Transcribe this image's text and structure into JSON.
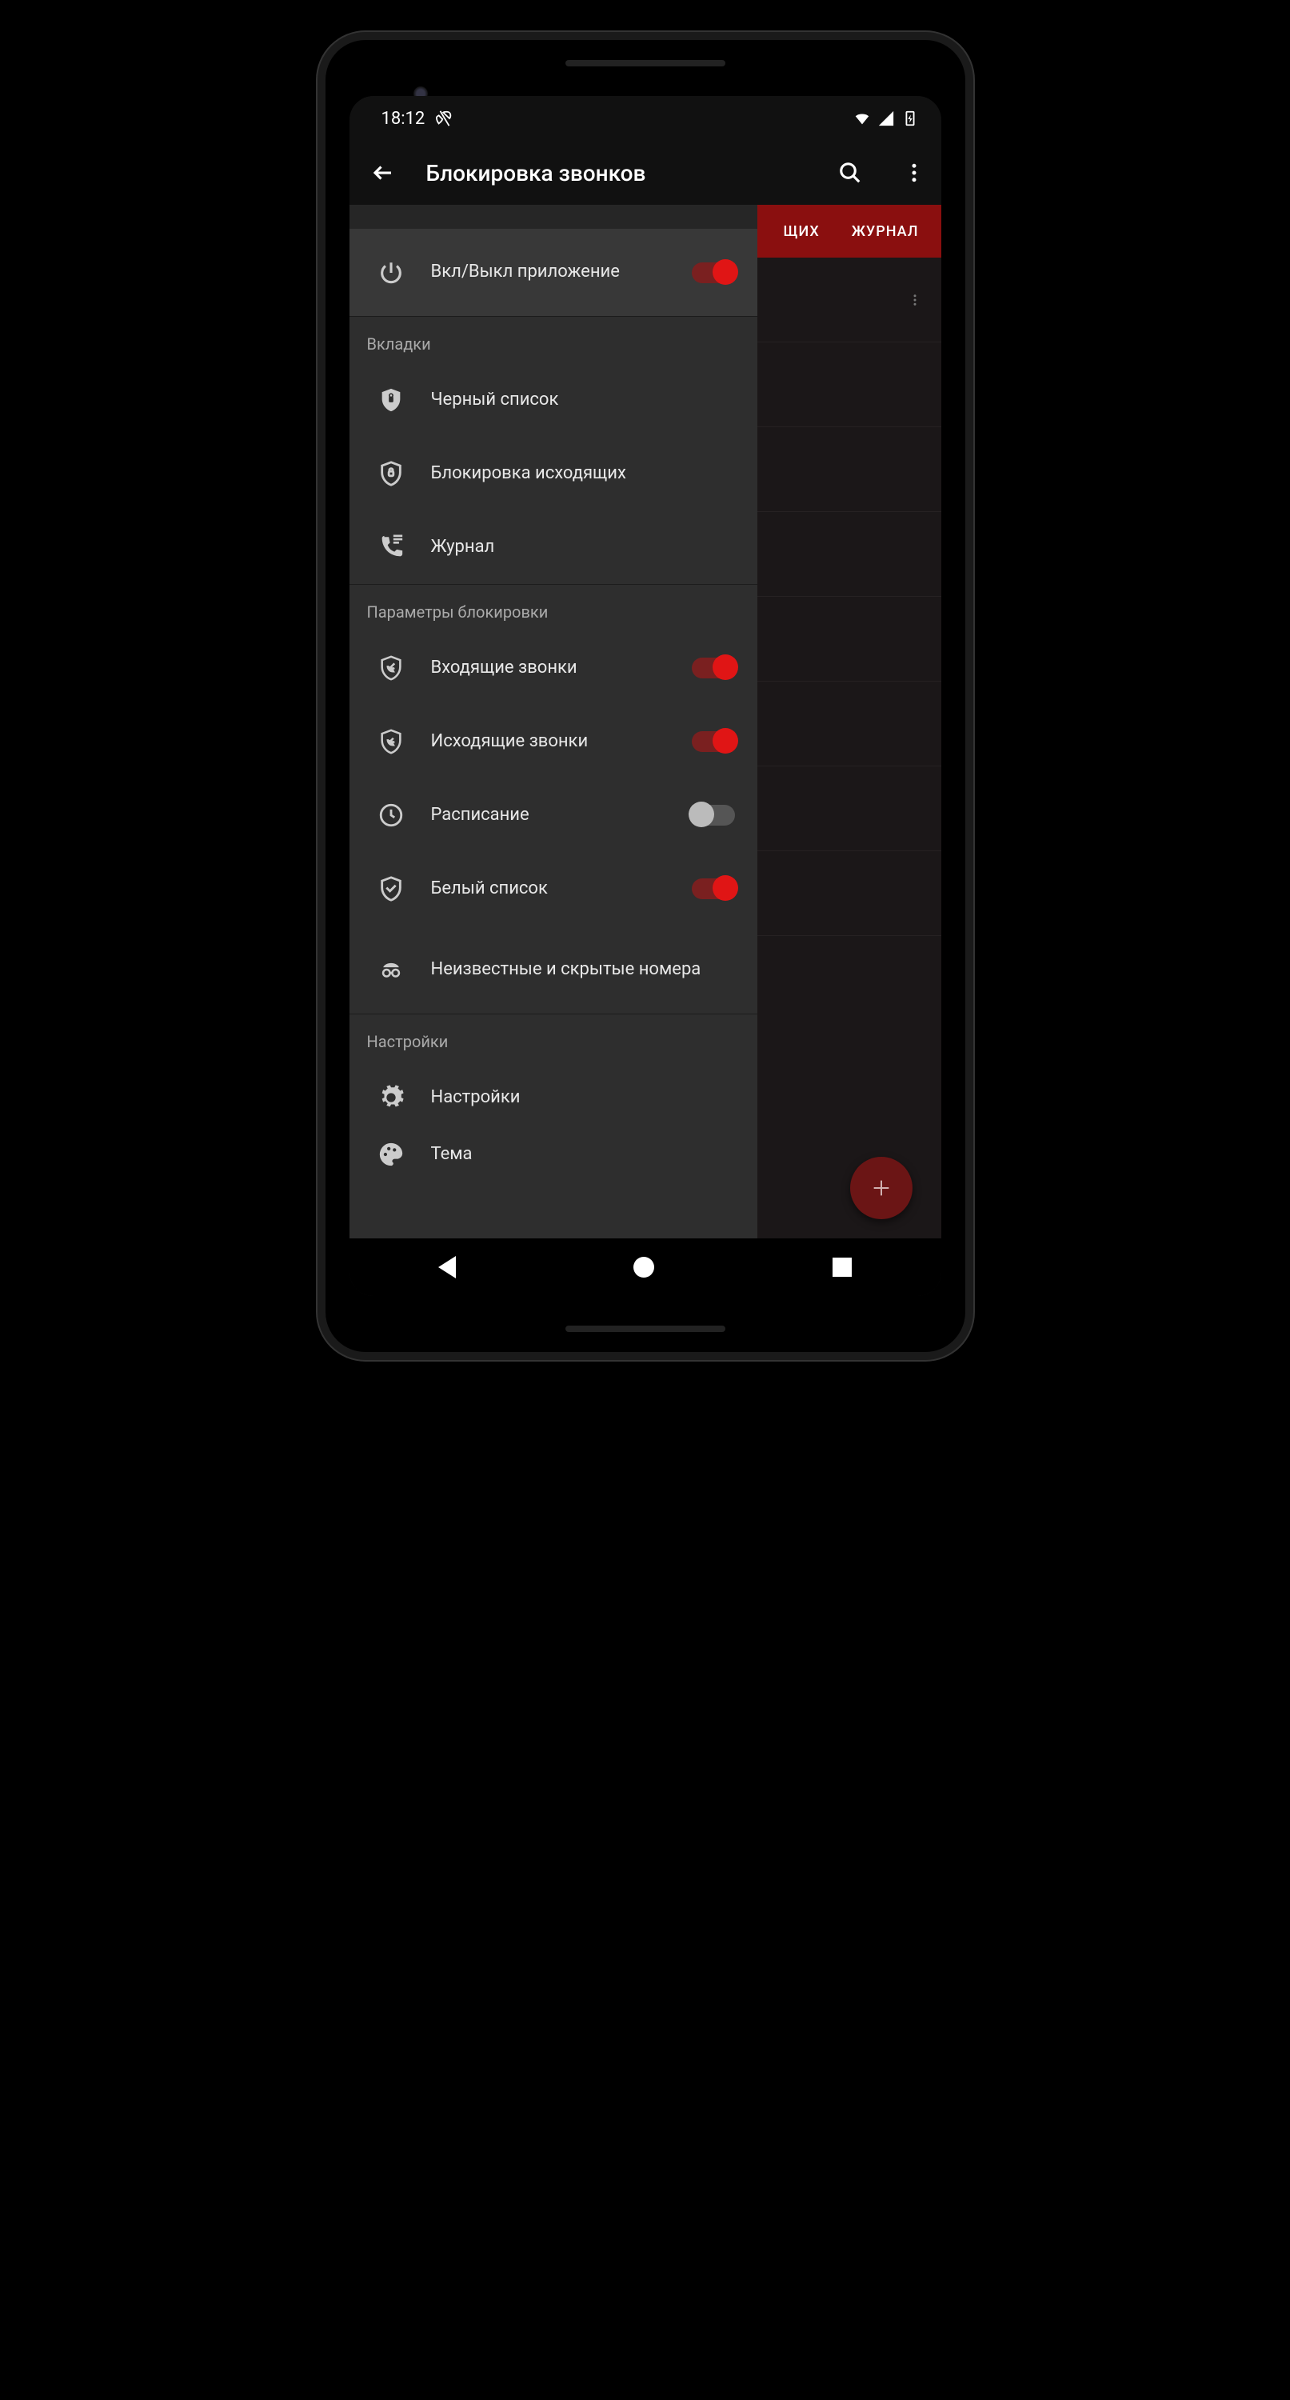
{
  "status_bar": {
    "time": "18:12"
  },
  "app_bar": {
    "title": "Блокировка звонков"
  },
  "tabs": {
    "partial_tab": "ЩИХ",
    "log_tab": "ЖУРНАЛ"
  },
  "drawer": {
    "app_toggle": {
      "label": "Вкл/Выкл приложение",
      "state": "on"
    },
    "tabs_section": {
      "header": "Вкладки",
      "blacklist": "Черный список",
      "outgoing_block": "Блокировка исходящих",
      "log": "Журнал"
    },
    "block_params": {
      "header": "Параметры блокировки",
      "incoming": {
        "label": "Входящие звонки",
        "state": "on"
      },
      "outgoing": {
        "label": "Исходящие звонки",
        "state": "on"
      },
      "schedule": {
        "label": "Расписание",
        "state": "off"
      },
      "whitelist": {
        "label": "Белый список",
        "state": "on"
      },
      "unknown": {
        "label": "Неизвестные и скрытые номера"
      }
    },
    "settings_section": {
      "header": "Настройки",
      "settings": "Настройки",
      "theme": "Тема"
    }
  },
  "colors": {
    "accent": "#e01515",
    "tab_bg": "#8a0f0f"
  }
}
